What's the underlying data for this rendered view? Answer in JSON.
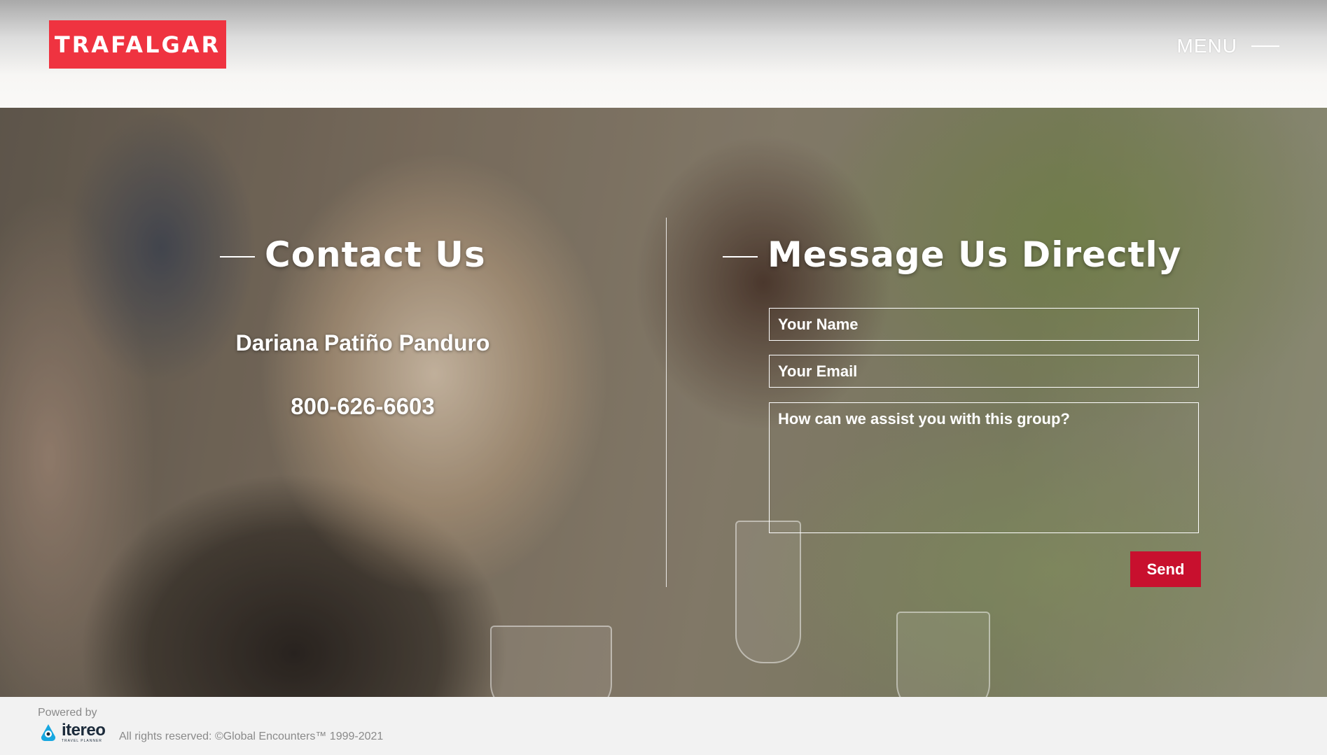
{
  "header": {
    "logo_text": "TRAFALGAR",
    "menu_label": "MENU"
  },
  "contact": {
    "title": "Contact Us",
    "name": "Dariana Patiño Panduro",
    "phone": "800-626-6603"
  },
  "message_form": {
    "title": "Message Us Directly",
    "name_placeholder": "Your Name",
    "email_placeholder": "Your Email",
    "message_placeholder": "How can we assist you with this group?",
    "send_label": "Send"
  },
  "footer": {
    "powered_by": "Powered by",
    "brand": "itereo",
    "brand_sub": "TRAVEL PLANNER",
    "rights": "All rights reserved: ©Global Encounters™ 1999-2021"
  },
  "colors": {
    "brand_red": "#ef3340",
    "send_red": "#c8102e"
  },
  "icons": {
    "menu": "menu-line-icon",
    "itereo": "itereo-logo-icon"
  }
}
